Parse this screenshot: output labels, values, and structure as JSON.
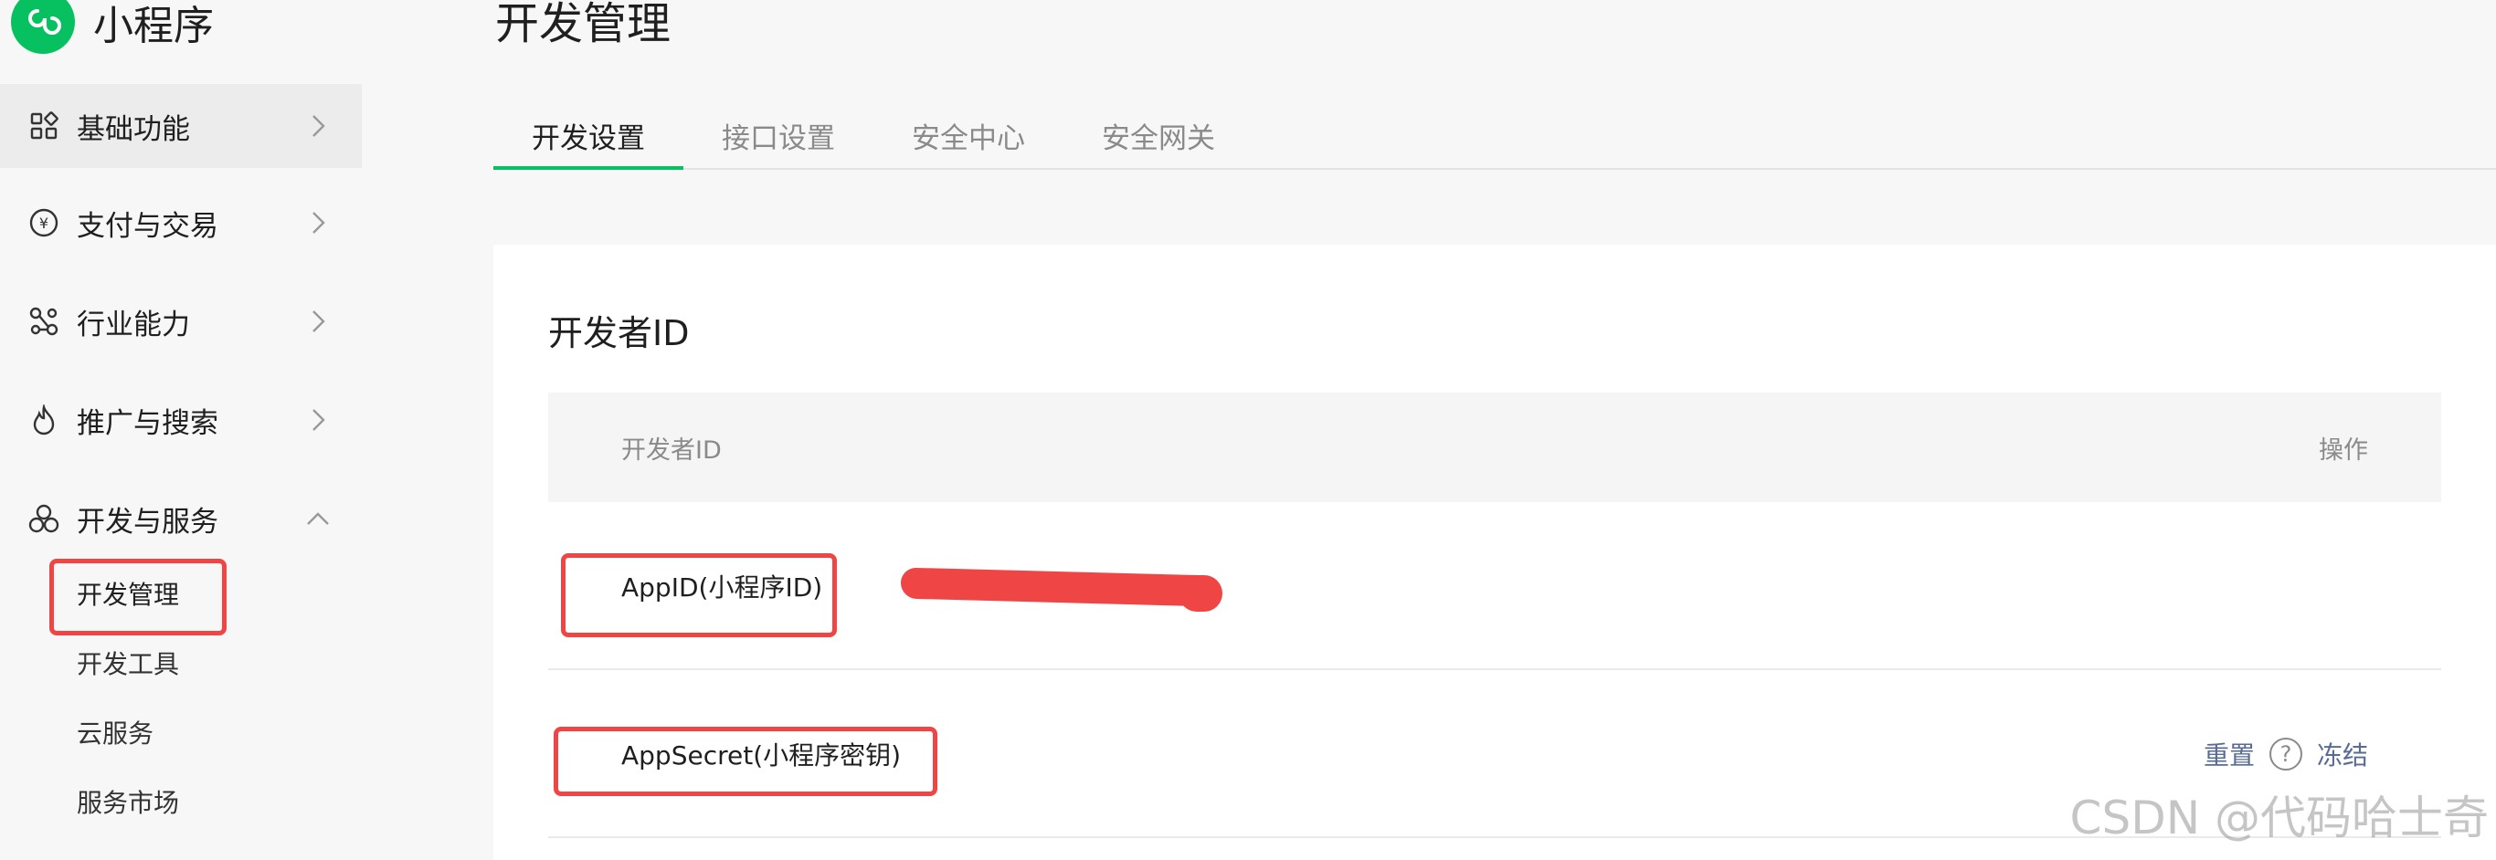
{
  "app": {
    "title": "小程序",
    "accent_color": "#07c160",
    "logo_icon": "miniprogram-logo-icon"
  },
  "sidebar": {
    "items": [
      {
        "label": "基础功能",
        "icon": "grid-icon",
        "chevron": "chevron-right-icon",
        "active": true
      },
      {
        "label": "支付与交易",
        "icon": "yen-circle-icon",
        "chevron": "chevron-right-icon"
      },
      {
        "label": "行业能力",
        "icon": "nodes-icon",
        "chevron": "chevron-right-icon"
      },
      {
        "label": "推广与搜索",
        "icon": "flame-icon",
        "chevron": "chevron-right-icon"
      },
      {
        "label": "开发与服务",
        "icon": "hexagons-icon",
        "chevron": "chevron-up-icon",
        "expanded": true
      }
    ],
    "subitems": [
      {
        "label": "开发管理",
        "selected": true
      },
      {
        "label": "开发工具"
      },
      {
        "label": "云服务"
      },
      {
        "label": "服务市场"
      }
    ]
  },
  "main": {
    "page_title": "开发管理",
    "tabs": [
      {
        "label": "开发设置",
        "active": true
      },
      {
        "label": "接口设置"
      },
      {
        "label": "安全中心"
      },
      {
        "label": "安全网关"
      }
    ],
    "card": {
      "title": "开发者ID",
      "table": {
        "columns": [
          "开发者ID",
          "操作"
        ],
        "rows": [
          {
            "label": "AppID(小程序ID)",
            "value_redacted": true
          },
          {
            "label": "AppSecret(小程序密钥)",
            "actions": [
              "重置",
              "冻结"
            ],
            "help_icon": "question-circle-icon"
          }
        ]
      }
    }
  },
  "colors": {
    "highlight": "#f04545",
    "link": "#576b95"
  },
  "watermark": "CSDN @代码哈士奇"
}
